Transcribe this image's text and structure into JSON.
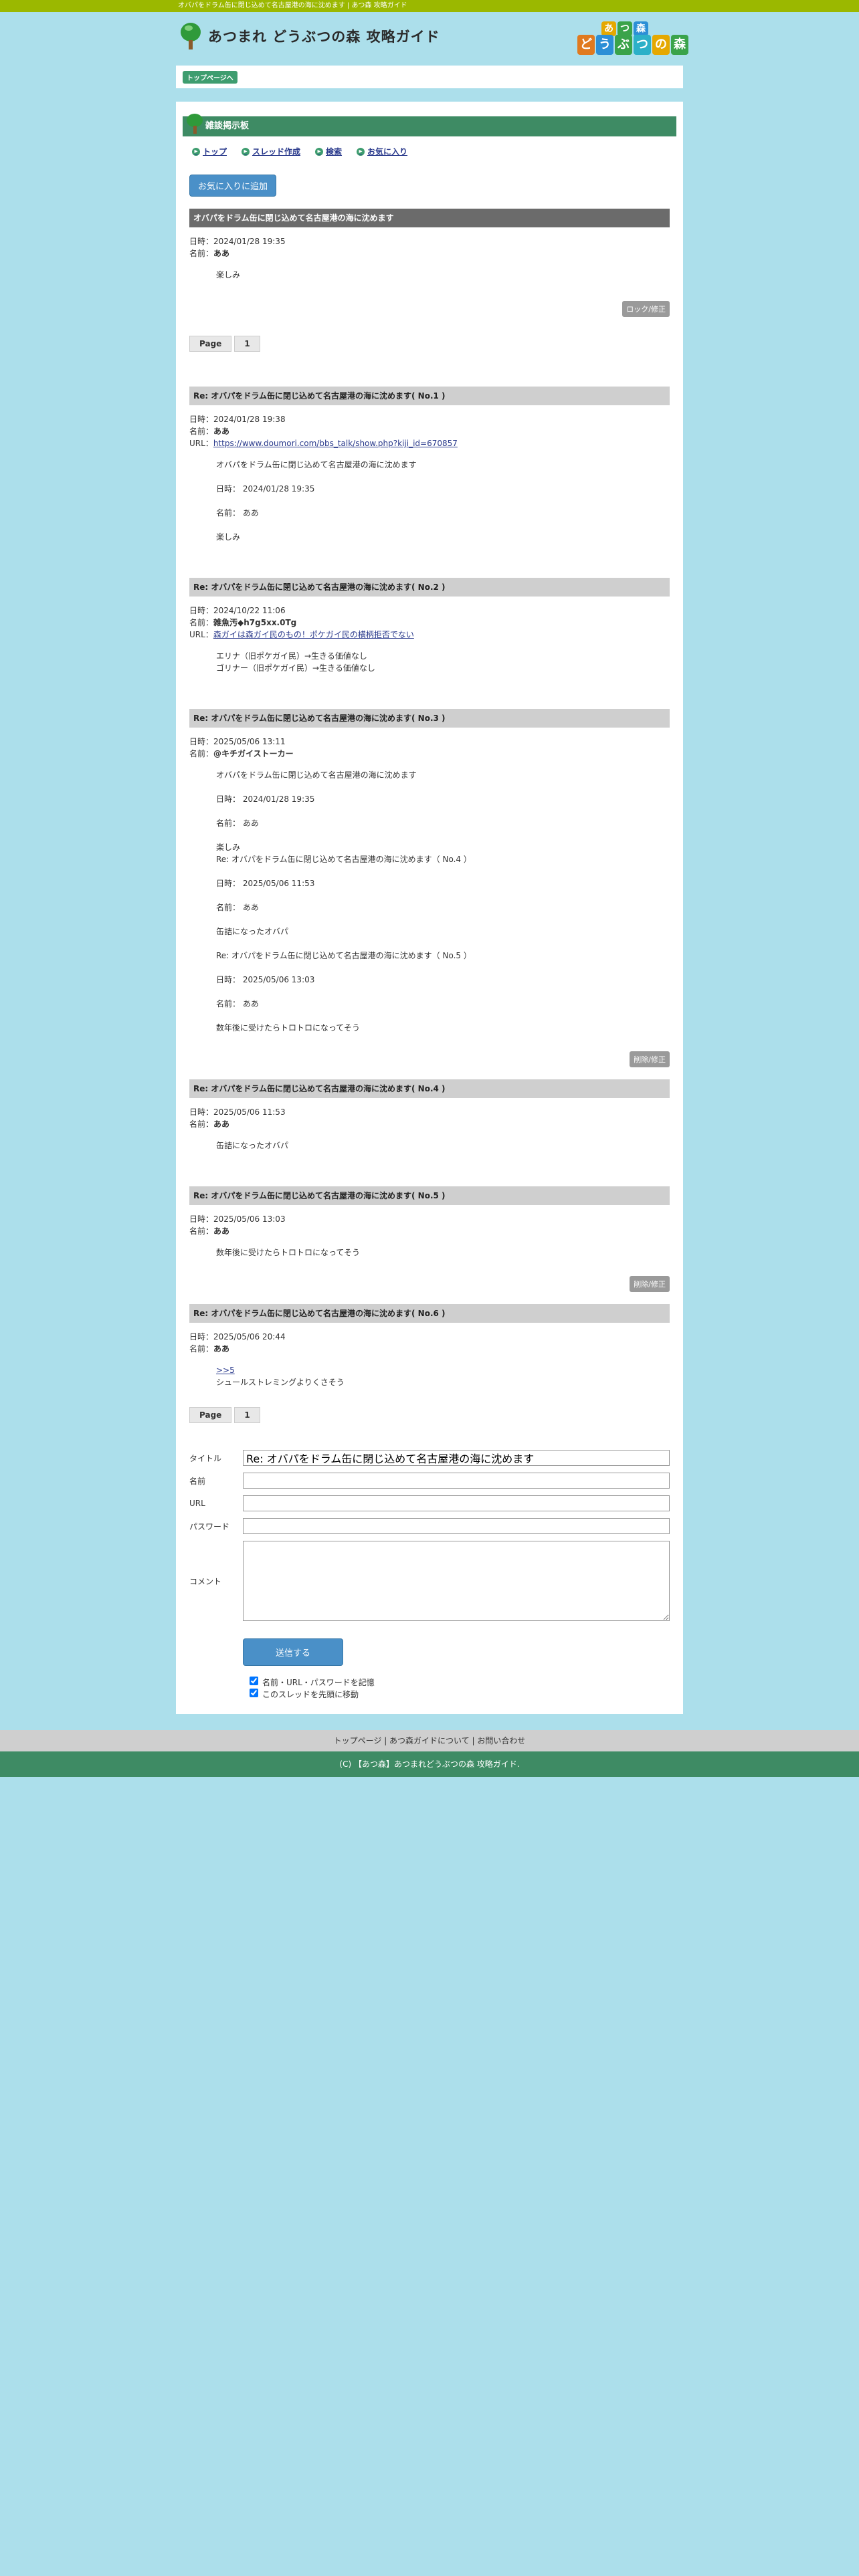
{
  "topbar": {
    "text": "オバパをドラム缶に閉じ込めて名古屋港の海に沈めます | あつ森 攻略ガイド"
  },
  "header": {
    "logo_text": "あつまれ どうぶつの森 攻略ガイド",
    "badge_row1": [
      "あ",
      "つ",
      "森"
    ],
    "badge_row2": [
      "ど",
      "う",
      "ぶ",
      "つ",
      "の",
      "森"
    ]
  },
  "breadcrumb": {
    "label": "トップページへ"
  },
  "board": {
    "title": "雑談掲示板",
    "nav": [
      "トップ",
      "スレッド作成",
      "検索",
      "お気に入り"
    ],
    "fav_button": "お気に入りに追加"
  },
  "labels": {
    "date": "日時：",
    "name": "名前：",
    "url": "URL："
  },
  "thread": {
    "title": "オバパをドラム缶に閉じ込めて名古屋港の海に沈めます",
    "date": "2024/01/28 19:35",
    "name": "ああ",
    "body": "楽しみ",
    "action": "ロック/修正"
  },
  "pager": {
    "label": "Page",
    "page": "1"
  },
  "replies": [
    {
      "title": "Re: オバパをドラム缶に閉じ込めて名古屋港の海に沈めます( No.1 )",
      "date": "2024/01/28 19:38",
      "name": "ああ",
      "url": "https://www.doumori.com/bbs_talk/show.php?kiji_id=670857",
      "body": "オバパをドラム缶に閉じ込めて名古屋港の海に沈めます\n\n日時： 2024/01/28 19:35\n\n名前： ああ\n\n楽しみ"
    },
    {
      "title": "Re: オバパをドラム缶に閉じ込めて名古屋港の海に沈めます( No.2 )",
      "date": "2024/10/22 11:06",
      "name": "雑魚汚◆h7g5xx.0Tg",
      "url": "森ガイは森ガイ民のもの！ポケガイ民の横柄拒否でない",
      "body": "エリナ（旧ポケガイ民）→生きる価値なし\nゴリナー（旧ポケガイ民）→生きる価値なし"
    },
    {
      "title": "Re: オバパをドラム缶に閉じ込めて名古屋港の海に沈めます( No.3 )",
      "date": "2025/05/06 13:11",
      "name": "@キチガイストーカー",
      "body": "オバパをドラム缶に閉じ込めて名古屋港の海に沈めます\n\n日時： 2024/01/28 19:35\n\n名前： ああ\n\n楽しみ\nRe: オバパをドラム缶に閉じ込めて名古屋港の海に沈めます（ No.4 ）\n\n日時： 2025/05/06 11:53\n\n名前： ああ\n\n缶詰になったオバパ\n\nRe: オバパをドラム缶に閉じ込めて名古屋港の海に沈めます（ No.5 ）\n\n日時： 2025/05/06 13:03\n\n名前： ああ\n\n数年後に受けたらトロトロになってそう",
      "action": "削除/修正"
    },
    {
      "title": "Re: オバパをドラム缶に閉じ込めて名古屋港の海に沈めます( No.4 )",
      "date": "2025/05/06 11:53",
      "name": "ああ",
      "body": "缶詰になったオバパ"
    },
    {
      "title": "Re: オバパをドラム缶に閉じ込めて名古屋港の海に沈めます( No.5 )",
      "date": "2025/05/06 13:03",
      "name": "ああ",
      "body": "数年後に受けたらトロトロになってそう",
      "action": "削除/修正"
    },
    {
      "title": "Re: オバパをドラム缶に閉じ込めて名古屋港の海に沈めます( No.6 )",
      "date": "2025/05/06 20:44",
      "name": "ああ",
      "link": ">>5",
      "body": "シュールストレミングよりくさそう"
    }
  ],
  "form": {
    "title_label": "タイトル",
    "title_value": "Re: オバパをドラム缶に閉じ込めて名古屋港の海に沈めます",
    "name_label": "名前",
    "url_label": "URL",
    "password_label": "パスワード",
    "comment_label": "コメント",
    "submit": "送信する",
    "check1": "名前・URL・パスワードを記憶",
    "check2": "このスレッドを先頭に移動"
  },
  "footer": {
    "links": "トップページ | あつ森ガイドについて | お問い合わせ",
    "copyright": "(C) 【あつ森】あつまれどうぶつの森 攻略ガイド."
  },
  "colors": {
    "accent_green": "#3e8b64",
    "top_bar": "#9bb800",
    "bg": "#acdfeb",
    "button_blue": "#4a90c8"
  }
}
